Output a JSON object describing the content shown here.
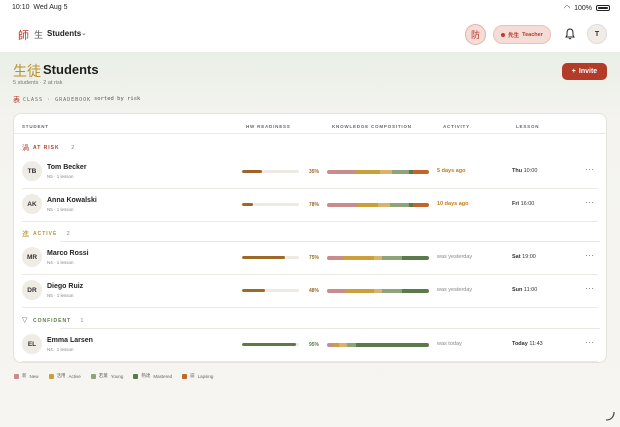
{
  "status": {
    "time": "10:10",
    "date": "Wed Aug 5",
    "battery": "100%"
  },
  "topbar": {
    "logo": "師",
    "app_kanji": "生",
    "app_title": "Students",
    "kanji_button": "防",
    "teacher_kanji": "先生",
    "teacher_label": "Teacher",
    "avatar": "T"
  },
  "heading": {
    "kanji": "生徒",
    "title": "Students",
    "subtitle": "5 students · 2 at risk",
    "invite_label": "Invite",
    "crumb_kanji": "表",
    "crumb": "CLASS · GRADEBOOK",
    "crumb_sort": "sorted by risk"
  },
  "table": {
    "columns": [
      "STUDENT",
      "HW READINESS",
      "KNOWLEDGE COMPOSITION",
      "ACTIVITY",
      "LESSON"
    ],
    "groups": [
      {
        "kanji": "渦",
        "label": "AT RISK",
        "count": "2",
        "color": "#b23b2a"
      },
      {
        "kanji": "進",
        "label": "ACTIVE",
        "count": "2",
        "color": "#b89230"
      },
      {
        "kanji": "▽",
        "label": "CONFIDENT",
        "count": "1",
        "color": "#5b7a4a"
      }
    ],
    "rows": [
      {
        "initials": "TB",
        "name": "Tom Becker",
        "meta": "N5 · 1 lesson",
        "hw": 35,
        "hw_label": "35%",
        "hw_color": "#a0642a",
        "kc": [
          28,
          24,
          12,
          16,
          4,
          16
        ],
        "activity": "5 days ago",
        "activity_color": "#c27a1a",
        "lesson_day": "Thu",
        "lesson_time": "10:00"
      },
      {
        "initials": "AK",
        "name": "Anna Kowalski",
        "meta": "N5 · 1 lesson",
        "hw": 20,
        "hw_label": "78%",
        "hw_color": "#a0642a",
        "kc": [
          30,
          20,
          12,
          18,
          4,
          16
        ],
        "activity": "10 days ago",
        "activity_color": "#c27a1a",
        "lesson_day": "Fri",
        "lesson_time": "16:00"
      },
      {
        "initials": "MR",
        "name": "Marco Rossi",
        "meta": "N4 · 1 lesson",
        "hw": 75,
        "hw_label": "75%",
        "hw_color": "#9a6a26",
        "kc": [
          16,
          30,
          8,
          20,
          26,
          0
        ],
        "activity": "was yesterday",
        "activity_color": "#888888",
        "lesson_day": "Sat",
        "lesson_time": "19:00"
      },
      {
        "initials": "DR",
        "name": "Diego Ruiz",
        "meta": "N5 · 1 lesson",
        "hw": 40,
        "hw_label": "48%",
        "hw_color": "#9a6a26",
        "kc": [
          18,
          28,
          8,
          20,
          26,
          0
        ],
        "activity": "was yesterday",
        "activity_color": "#888888",
        "lesson_day": "Sun",
        "lesson_time": "11:00"
      },
      {
        "initials": "EL",
        "name": "Emma Larsen",
        "meta": "N4 · 1 lesson",
        "hw": 95,
        "hw_label": "95%",
        "hw_color": "#5b7a4a",
        "kc": [
          6,
          6,
          8,
          8,
          72,
          0
        ],
        "activity": "was today",
        "activity_color": "#888888",
        "lesson_day": "Today",
        "lesson_time": "11:43"
      }
    ]
  },
  "legend": [
    {
      "kanji": "新",
      "label": "New",
      "color": "#c98b8b"
    },
    {
      "kanji": "活用",
      "label": "Active",
      "color": "#c9a03a"
    },
    {
      "kanji": "若葉",
      "label": "Young",
      "color": "#8fa37a"
    },
    {
      "kanji": "熟達",
      "label": "Mastered",
      "color": "#5b7a4a"
    },
    {
      "kanji": "崩",
      "label": "Lapsing",
      "color": "#c0662a"
    }
  ],
  "kc_colors": [
    "#c98b8b",
    "#c9a03a",
    "#d7b46a",
    "#8fa37a",
    "#5b7a4a",
    "#c0662a"
  ]
}
